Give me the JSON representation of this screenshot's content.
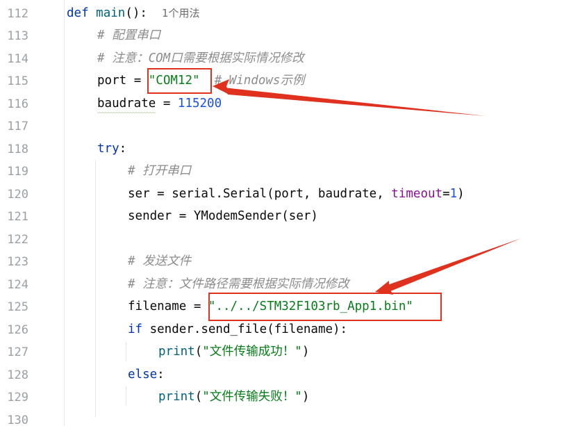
{
  "line_numbers": [
    "112",
    "113",
    "114",
    "115",
    "116",
    "117",
    "118",
    "119",
    "120",
    "121",
    "122",
    "123",
    "124",
    "125",
    "126",
    "127",
    "128",
    "129",
    "130"
  ],
  "code": {
    "l112": {
      "kw": "def",
      "name": "main",
      "sig": "():",
      "hint": "1个用法"
    },
    "l113": {
      "comment": "# 配置串口"
    },
    "l114": {
      "comment": "# 注意：COM口需要根据实际情况修改"
    },
    "l115": {
      "var": "port",
      "op": " = ",
      "str": "\"COM12\"",
      "comment": "# Windows示例"
    },
    "l116": {
      "var": "baudrate",
      "op": " = ",
      "num": "115200"
    },
    "l118": {
      "kw": "try",
      "colon": ":"
    },
    "l119": {
      "comment": "# 打开串口"
    },
    "l120": {
      "pre": "ser = serial.Serial(port, baudrate, ",
      "param": "timeout",
      "eq": "=",
      "num": "1",
      "post": ")"
    },
    "l121": {
      "text": "sender = YModemSender(ser)"
    },
    "l123": {
      "comment": "# 发送文件"
    },
    "l124": {
      "comment": "# 注意：文件路径需要根据实际情况修改"
    },
    "l125": {
      "var": "filename",
      "op": " = ",
      "str": "\"../../STM32F103rb_App1.bin\""
    },
    "l126": {
      "kw": "if",
      "rest": " sender.send_file(filename):"
    },
    "l127": {
      "fn": "print",
      "open": "(",
      "str": "\"文件传输成功！\"",
      "close": ")"
    },
    "l128": {
      "kw": "else",
      "colon": ":"
    },
    "l129": {
      "fn": "print",
      "open": "(",
      "str": "\"文件传输失败！\"",
      "close": ")"
    }
  },
  "colors": {
    "keyword": "#0033b3",
    "function": "#00627a",
    "string": "#067d17",
    "number": "#1750eb",
    "comment": "#8c8c8c",
    "annotation": "#e0301e"
  }
}
